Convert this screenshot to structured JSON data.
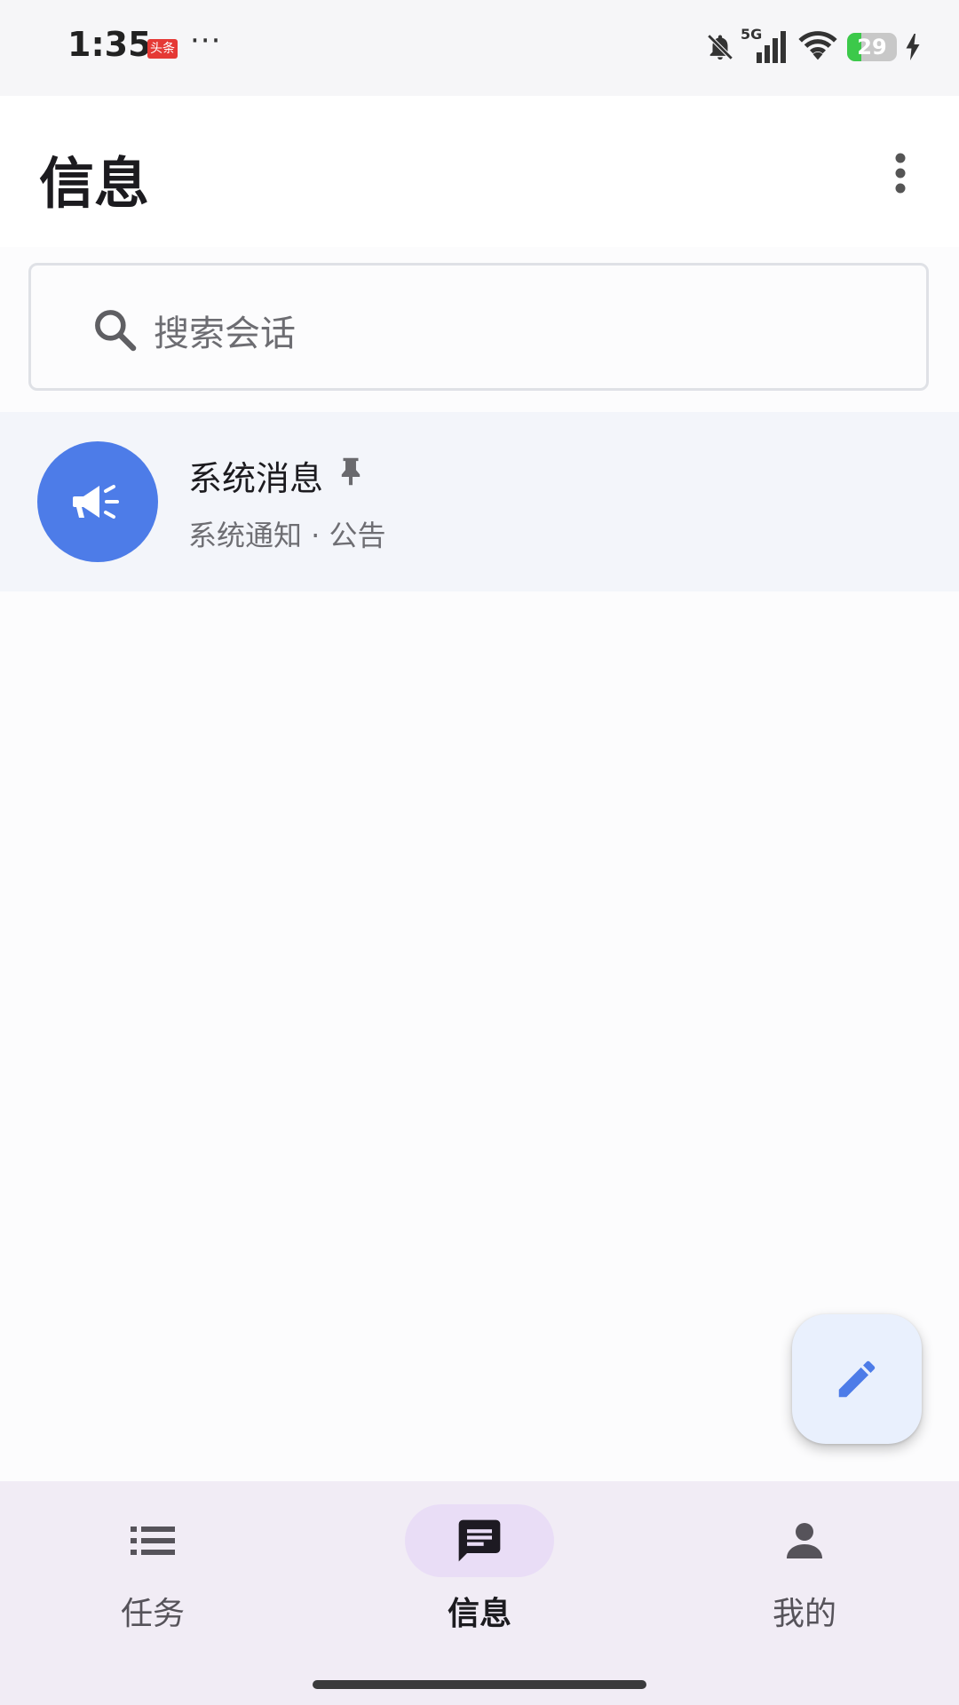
{
  "status_bar": {
    "time": "1:35",
    "app_badge": "头条",
    "more_dots": "···",
    "network": "5G",
    "battery": "29"
  },
  "header": {
    "title": "信息"
  },
  "search": {
    "placeholder": "搜索会话"
  },
  "conversations": [
    {
      "title": "系统消息",
      "subtitle": "系统通知 · 公告",
      "pinned": true,
      "avatar_icon": "megaphone-icon",
      "avatar_color": "#4d7ce8"
    }
  ],
  "fab": {
    "icon": "pencil-icon",
    "color": "#4d7ce8"
  },
  "bottom_nav": {
    "items": [
      {
        "label": "任务",
        "icon": "list-icon",
        "active": false
      },
      {
        "label": "信息",
        "icon": "chat-icon",
        "active": true
      },
      {
        "label": "我的",
        "icon": "person-icon",
        "active": false
      }
    ]
  },
  "colors": {
    "accent": "#4d7ce8",
    "nav_background": "#f1ecf5",
    "nav_active_pill": "#e9ddf6",
    "list_item_background": "#f3f5fa"
  }
}
